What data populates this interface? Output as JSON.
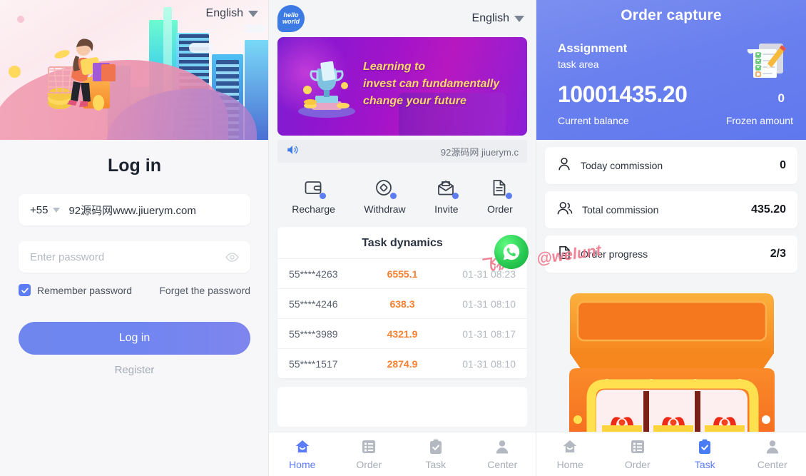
{
  "login": {
    "language": "English",
    "title": "Log in",
    "country_code": "+55",
    "phone_value": "92源码网www.jiuerym.com",
    "password_placeholder": "Enter password",
    "remember_label": "Remember password",
    "forget_label": "Forget the password",
    "login_button": "Log in",
    "register_label": "Register",
    "accent": "#6e86ee"
  },
  "home": {
    "logo_text_1": "hello",
    "logo_text_2": "world",
    "language": "English",
    "banner_line1": "Learning to",
    "banner_line2": "invest can fundamentally",
    "banner_line3": "change your future",
    "notice_text": "92源码网 jiuerym.c",
    "quick_actions": [
      {
        "label": "Recharge",
        "icon": "wallet-icon"
      },
      {
        "label": "Withdraw",
        "icon": "withdraw-icon"
      },
      {
        "label": "Invite",
        "icon": "envelope-icon"
      },
      {
        "label": "Order",
        "icon": "document-icon"
      }
    ],
    "task_dynamics_title": "Task dynamics",
    "task_dynamics_rows": [
      {
        "user": "55****4263",
        "amount": "6555.1",
        "time": "01-31 08:23"
      },
      {
        "user": "55****4246",
        "amount": "638.3",
        "time": "01-31 08:10"
      },
      {
        "user": "55****3989",
        "amount": "4321.9",
        "time": "01-31 08:17"
      },
      {
        "user": "55****1517",
        "amount": "2874.9",
        "time": "01-31 08:10"
      }
    ],
    "amount_color": "#f98032",
    "tabs": [
      {
        "label": "Home",
        "icon": "home-icon",
        "active": true
      },
      {
        "label": "Order",
        "icon": "list-icon",
        "active": false
      },
      {
        "label": "Task",
        "icon": "clipboard-icon",
        "active": false
      },
      {
        "label": "Center",
        "icon": "person-icon",
        "active": false
      }
    ]
  },
  "task": {
    "header_title": "Order capture",
    "assignment_title": "Assignment",
    "assignment_sub": "task area",
    "current_balance": "10001435.20",
    "frozen_amount": "0",
    "current_balance_label": "Current balance",
    "frozen_amount_label": "Frozen amount",
    "header_color": "#6a80ee",
    "stats": [
      {
        "label": "Today commission",
        "value": "0",
        "icon": "person-icon"
      },
      {
        "label": "Total commission",
        "value": "435.20",
        "icon": "people-icon"
      },
      {
        "label": "Order progress",
        "value": "2/3",
        "icon": "document-icon"
      }
    ],
    "tabs": [
      {
        "label": "Home",
        "icon": "home-icon",
        "active": false
      },
      {
        "label": "Order",
        "icon": "list-icon",
        "active": false
      },
      {
        "label": "Task",
        "icon": "clipboard-icon",
        "active": true
      },
      {
        "label": "Center",
        "icon": "person-icon",
        "active": false
      }
    ]
  },
  "watermark": {
    "chinese": "飞机:",
    "handle": "@welunt"
  }
}
